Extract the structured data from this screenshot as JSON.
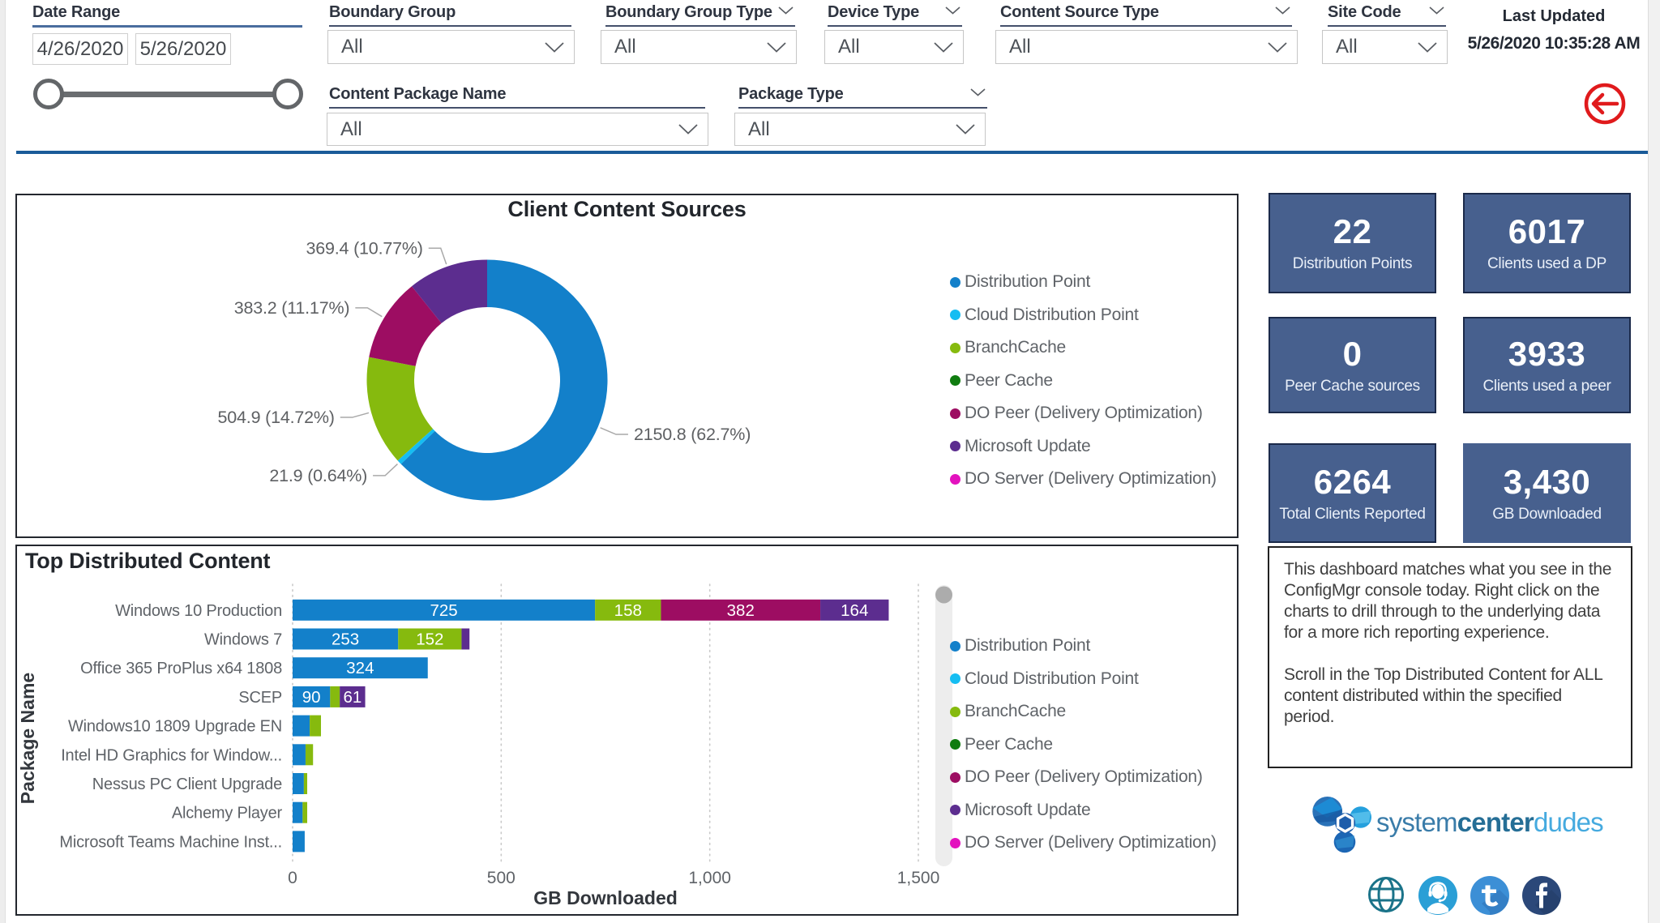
{
  "filters": {
    "date_range": {
      "label": "Date Range",
      "start": "4/26/2020",
      "end": "5/26/2020"
    },
    "boundary_group": {
      "label": "Boundary Group",
      "value": "All"
    },
    "boundary_group_type": {
      "label": "Boundary Group Type",
      "value": "All"
    },
    "device_type": {
      "label": "Device Type",
      "value": "All"
    },
    "content_source_type": {
      "label": "Content Source Type",
      "value": "All"
    },
    "site_code": {
      "label": "Site Code",
      "value": "All"
    },
    "content_package_name": {
      "label": "Content Package Name",
      "value": "All"
    },
    "package_type": {
      "label": "Package Type",
      "value": "All"
    },
    "last_updated": {
      "label": "Last Updated",
      "value": "5/26/2020 10:35:28 AM"
    }
  },
  "panels": {
    "donut_title": "Client Content Sources",
    "bars_title": "Top Distributed Content"
  },
  "kpis": [
    {
      "value": "22",
      "label": "Distribution Points"
    },
    {
      "value": "6017",
      "label": "Clients used a DP"
    },
    {
      "value": "0",
      "label": "Peer Cache sources"
    },
    {
      "value": "3933",
      "label": "Clients used a peer"
    },
    {
      "value": "6264",
      "label": "Total Clients Reported"
    },
    {
      "value": "3,430",
      "label": "GB Downloaded"
    }
  ],
  "legend_entries": [
    {
      "key": "dp",
      "label": "Distribution Point",
      "color": "#1380ca"
    },
    {
      "key": "cdp",
      "label": "Cloud Distribution Point",
      "color": "#15bdf2"
    },
    {
      "key": "bc",
      "label": "BranchCache",
      "color": "#86ba0e"
    },
    {
      "key": "pc",
      "label": "Peer Cache",
      "color": "#107c10"
    },
    {
      "key": "dop",
      "label": "DO Peer (Delivery Optimization)",
      "color": "#9d0d62"
    },
    {
      "key": "mu",
      "label": "Microsoft Update",
      "color": "#5c2d8f"
    },
    {
      "key": "dos",
      "label": "DO Server (Delivery Optimization)",
      "color": "#e312be"
    }
  ],
  "chart_data": [
    {
      "type": "pie",
      "title": "Client Content Sources",
      "donut": true,
      "categories": [
        "Distribution Point",
        "Cloud Distribution Point",
        "BranchCache",
        "Peer Cache",
        "DO Peer (Delivery Optimization)",
        "Microsoft Update",
        "DO Server (Delivery Optimization)"
      ],
      "series_keys": [
        "dp",
        "cdp",
        "bc",
        "pc",
        "dop",
        "mu",
        "dos"
      ],
      "values": [
        2150.8,
        21.9,
        504.9,
        0,
        383.2,
        369.4,
        0
      ],
      "labels": [
        "2150.8 (62.7%)",
        "21.9 (0.64%)",
        "504.9 (14.72%)",
        "",
        "383.2 (11.17%)",
        "369.4 (10.77%)",
        ""
      ],
      "legend_position": "right"
    },
    {
      "type": "bar",
      "title": "Top Distributed Content",
      "orientation": "horizontal",
      "stacked": true,
      "xlabel": "GB Downloaded",
      "ylabel": "Package Name",
      "xlim": [
        0,
        1500
      ],
      "ticks": [
        0,
        500,
        1000,
        1500
      ],
      "tick_labels": [
        "0",
        "500",
        "1,000",
        "1,500"
      ],
      "grid": "dotted",
      "legend_position": "right",
      "categories": [
        "Windows 10 Production",
        "Windows 7",
        "Office 365 ProPlus x64 1808",
        "SCEP",
        "Windows10 1809 Upgrade EN",
        "Intel HD Graphics for Window...",
        "Nessus PC Client Upgrade",
        "Alchemy Player",
        "Microsoft Teams Machine Inst..."
      ],
      "rows": [
        [
          {
            "s": "dp",
            "v": 725,
            "label": "725"
          },
          {
            "s": "bc",
            "v": 158,
            "label": "158"
          },
          {
            "s": "dop",
            "v": 382,
            "label": "382"
          },
          {
            "s": "mu",
            "v": 164,
            "label": "164"
          }
        ],
        [
          {
            "s": "dp",
            "v": 253,
            "label": "253"
          },
          {
            "s": "bc",
            "v": 152,
            "label": "152"
          },
          {
            "s": "mu",
            "v": 19
          }
        ],
        [
          {
            "s": "dp",
            "v": 324,
            "label": "324"
          }
        ],
        [
          {
            "s": "dp",
            "v": 90,
            "label": "90"
          },
          {
            "s": "bc",
            "v": 23
          },
          {
            "s": "mu",
            "v": 61,
            "label": "61"
          }
        ],
        [
          {
            "s": "dp",
            "v": 41
          },
          {
            "s": "bc",
            "v": 27
          }
        ],
        [
          {
            "s": "dp",
            "v": 31
          },
          {
            "s": "bc",
            "v": 18
          }
        ],
        [
          {
            "s": "dp",
            "v": 27
          },
          {
            "s": "bc",
            "v": 8
          }
        ],
        [
          {
            "s": "dp",
            "v": 24
          },
          {
            "s": "bc",
            "v": 11
          }
        ],
        [
          {
            "s": "dp",
            "v": 29
          }
        ]
      ]
    }
  ],
  "info_box": {
    "paragraph1": "This dashboard matches what you see in the ConfigMgr console today. Right click on the charts to drill through to the underlying data for a more rich reporting experience.",
    "paragraph2": "Scroll in the Top Distributed Content for ALL content distributed within the specified period."
  },
  "brand": {
    "logo_part1": "system",
    "logo_part2": "center",
    "logo_part3": "dudes",
    "social_icons": [
      "website-globe",
      "support-headset",
      "twitter",
      "facebook"
    ]
  },
  "colors": {
    "kpi_card_bg": "#47608e",
    "kpi_card_border": "#1b2a4a",
    "divider_blue": "#1a5b99",
    "back_button_red": "#e01a1c"
  }
}
